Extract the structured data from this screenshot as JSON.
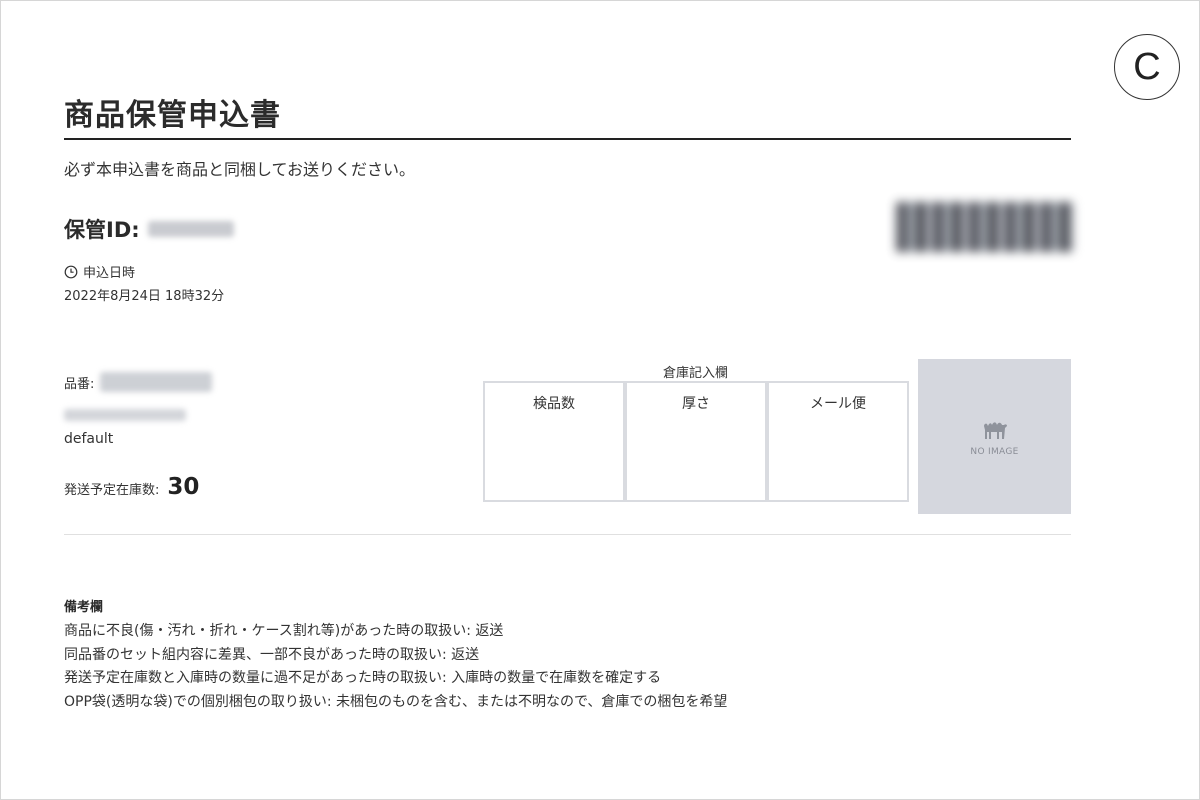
{
  "badge": {
    "letter": "C"
  },
  "form": {
    "title": "商品保管申込書",
    "notice": "必ず本申込書を商品と同梱してお送りください。",
    "storage_id_label": "保管ID:",
    "date_label": "申込日時",
    "date_value": "2022年8月24日 18時32分"
  },
  "item": {
    "number_label": "品番:",
    "variant": "default",
    "stock_label": "発送予定在庫数:",
    "stock_value": "30"
  },
  "warehouse": {
    "caption": "倉庫記入欄",
    "columns": [
      "検品数",
      "厚さ",
      "メール便"
    ]
  },
  "image": {
    "placeholder_text": "NO IMAGE",
    "background": "#d5d7de"
  },
  "remarks": {
    "title": "備考欄",
    "lines": [
      "商品に不良(傷・汚れ・折れ・ケース割れ等)があった時の取扱い: 返送",
      "同品番のセット組内容に差異、一部不良があった時の取扱い: 返送",
      "発送予定在庫数と入庫時の数量に過不足があった時の取扱い: 入庫時の数量で在庫数を確定する",
      "OPP袋(透明な袋)での個別梱包の取り扱い: 未梱包のものを含む、または不明なので、倉庫での梱包を希望"
    ]
  }
}
